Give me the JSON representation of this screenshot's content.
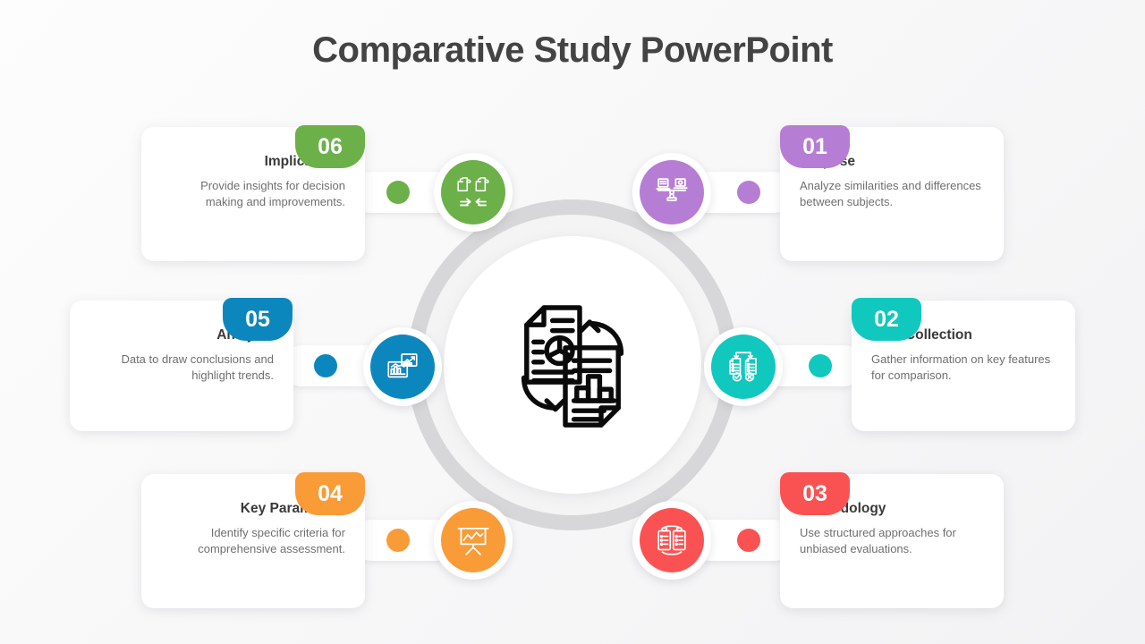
{
  "slide": {
    "title": "Comparative Study PowerPoint",
    "background_color": "#f5f5f6",
    "center_icon_name": "compare-documents-icon",
    "ring_color": "#d7d7d9"
  },
  "steps": [
    {
      "number": "01",
      "title": "Purpose",
      "description": "Analyze similarities and differences between subjects.",
      "color": "#b57ed4",
      "icon": "balance-scale-compare-icon",
      "side": "right",
      "position": "top-right"
    },
    {
      "number": "02",
      "title": "Data Collection",
      "description": "Gather information on key features for comparison.",
      "color": "#10c8bd",
      "icon": "checklist-documents-icon",
      "side": "right",
      "position": "middle-right"
    },
    {
      "number": "03",
      "title": "Methodology",
      "description": "Use structured approaches for unbiased evaluations.",
      "color": "#fa5252",
      "icon": "dual-clipboard-icon",
      "side": "right",
      "position": "bottom-right"
    },
    {
      "number": "04",
      "title": "Key Parameters",
      "description": "Identify specific criteria for comprehensive assessment.",
      "color": "#f99b37",
      "icon": "presentation-board-chart-icon",
      "side": "left",
      "position": "bottom-left"
    },
    {
      "number": "05",
      "title": "Analysis",
      "description": "Data to draw conclusions and highlight trends.",
      "color": "#0c87bd",
      "icon": "dual-chart-panels-icon",
      "side": "left",
      "position": "middle-left"
    },
    {
      "number": "06",
      "title": "Implications",
      "description": "Provide insights for decision making and improvements.",
      "color": "#6cb04a",
      "icon": "puzzle-exchange-icon",
      "side": "left",
      "position": "top-left"
    }
  ]
}
